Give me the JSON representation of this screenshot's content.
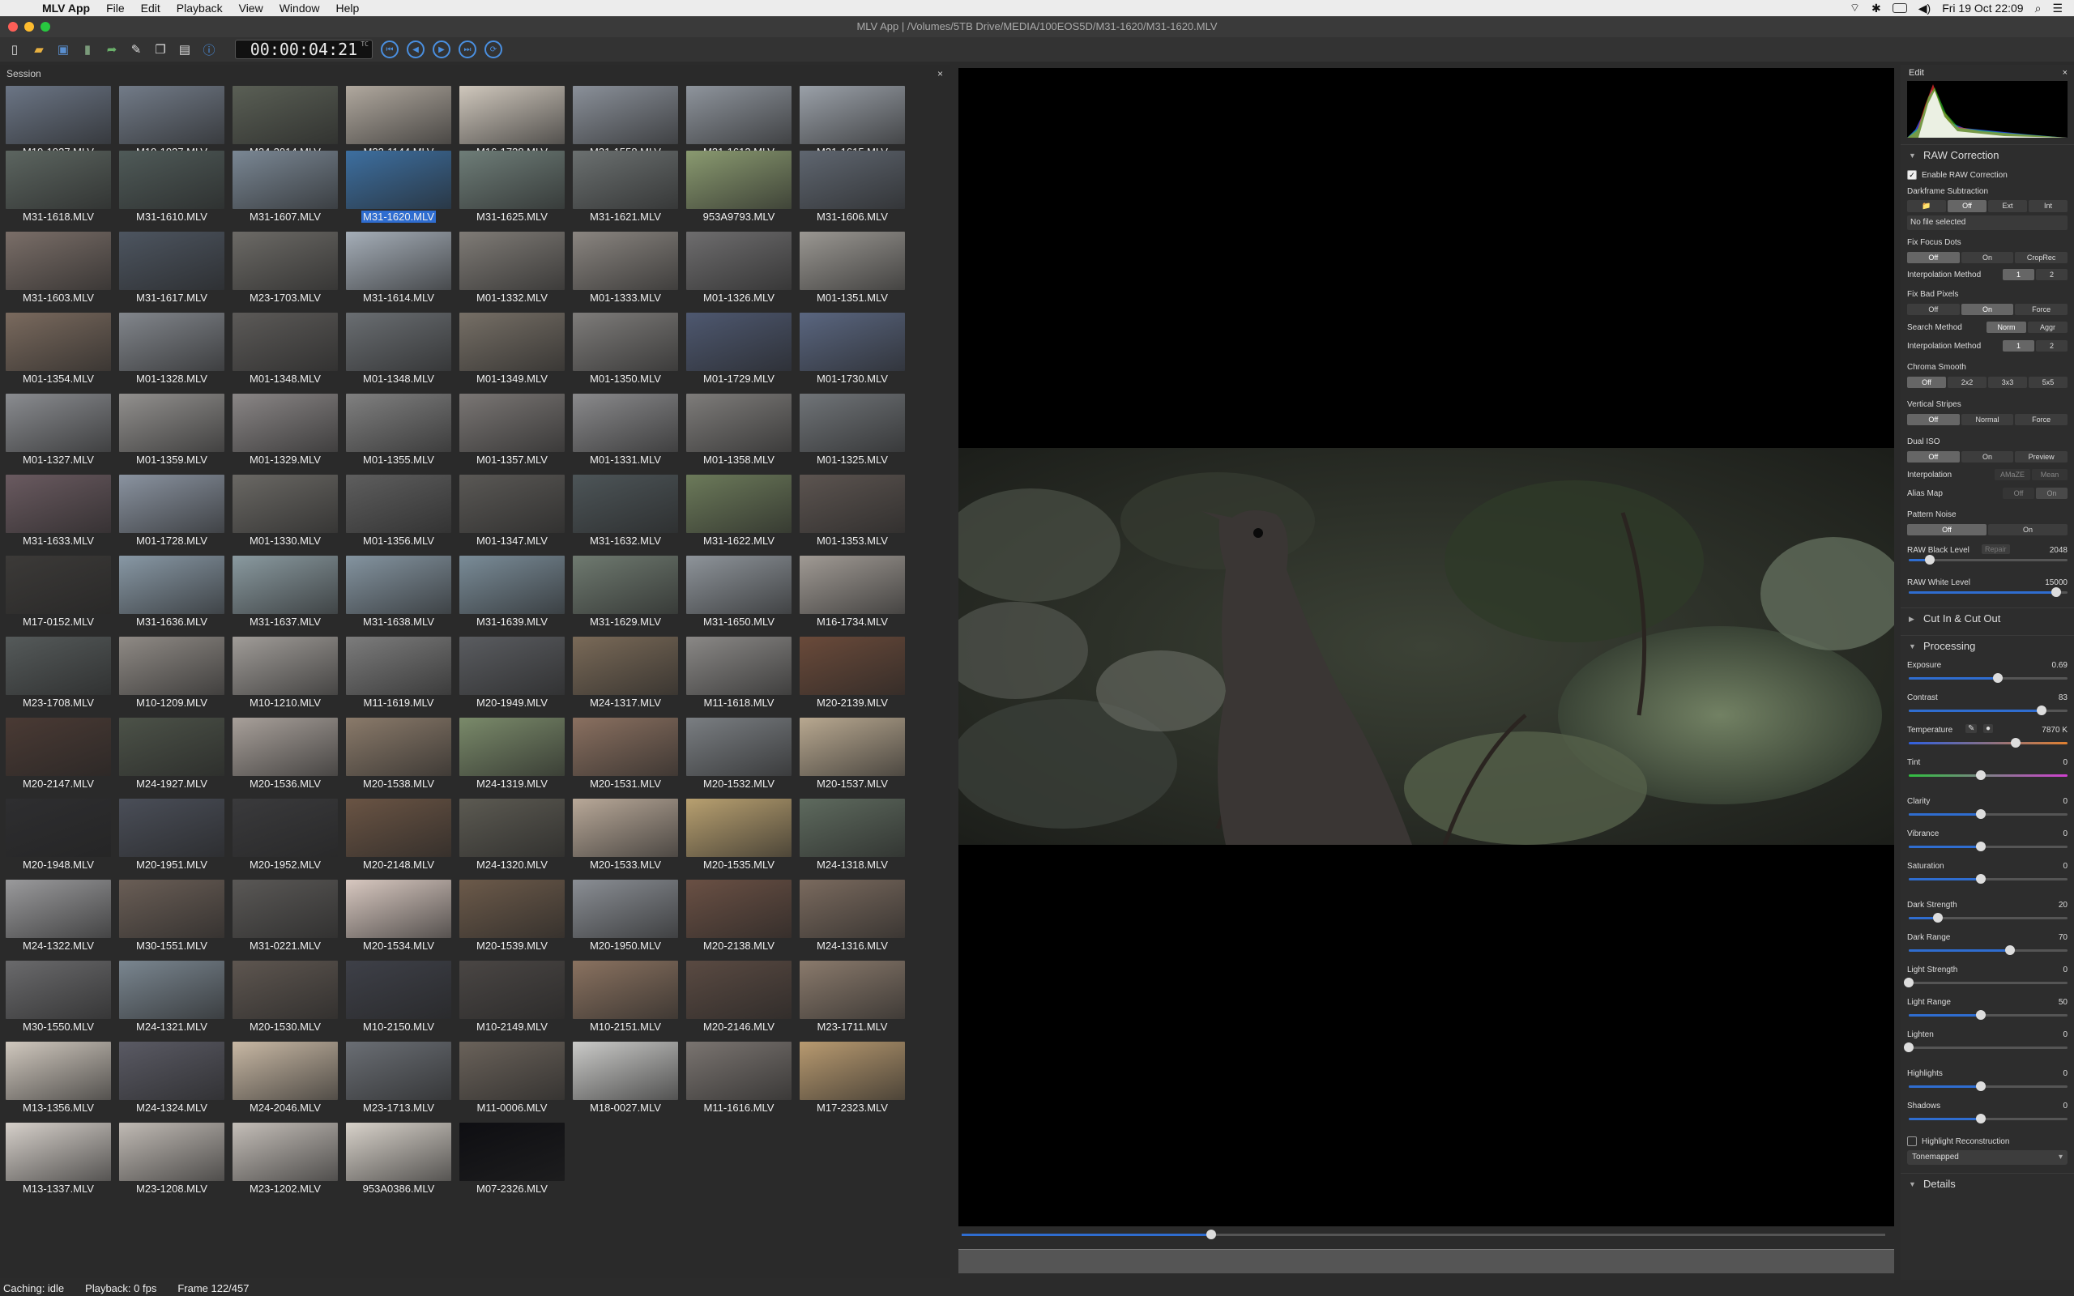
{
  "menubar": {
    "app": "MLV App",
    "menus": [
      "File",
      "Edit",
      "Playback",
      "View",
      "Window",
      "Help"
    ],
    "clock": "Fri 19 Oct  22:09"
  },
  "window": {
    "title": "MLV App | /Volumes/5TB Drive/MEDIA/100EOS5D/M31-1620/M31-1620.MLV"
  },
  "toolbar": {
    "timecode": "00:00:04:21",
    "tc_label": "TC",
    "icons": [
      "new-session-icon",
      "open-icon",
      "save-icon",
      "delete-icon",
      "export-icon",
      "settings-icon",
      "copy-icon",
      "paste-icon",
      "info-icon"
    ],
    "playback": [
      "skip-to-start-icon",
      "step-back-icon",
      "play-icon",
      "step-forward-icon",
      "loop-icon"
    ]
  },
  "session": {
    "header": "Session",
    "close": "×",
    "selected": "M31-1620.MLV",
    "files": [
      "M19-1937.MLV",
      "M19-1937.MLV",
      "M24-2014.MLV",
      "M23-1144.MLV",
      "M16-1738.MLV",
      "M31-1558.MLV",
      "M31-1612.MLV",
      "M31-1615.MLV",
      "M31-1618.MLV",
      "M31-1610.MLV",
      "M31-1607.MLV",
      "M31-1620.MLV",
      "M31-1625.MLV",
      "M31-1621.MLV",
      "953A9793.MLV",
      "M31-1606.MLV",
      "M31-1603.MLV",
      "M31-1617.MLV",
      "M23-1703.MLV",
      "M31-1614.MLV",
      "M01-1332.MLV",
      "M01-1333.MLV",
      "M01-1326.MLV",
      "M01-1351.MLV",
      "M01-1354.MLV",
      "M01-1328.MLV",
      "M01-1348.MLV",
      "M01-1348.MLV",
      "M01-1349.MLV",
      "M01-1350.MLV",
      "M01-1729.MLV",
      "M01-1730.MLV",
      "M01-1327.MLV",
      "M01-1359.MLV",
      "M01-1329.MLV",
      "M01-1355.MLV",
      "M01-1357.MLV",
      "M01-1331.MLV",
      "M01-1358.MLV",
      "M01-1325.MLV",
      "M31-1633.MLV",
      "M01-1728.MLV",
      "M01-1330.MLV",
      "M01-1356.MLV",
      "M01-1347.MLV",
      "M31-1632.MLV",
      "M31-1622.MLV",
      "M01-1353.MLV",
      "M17-0152.MLV",
      "M31-1636.MLV",
      "M31-1637.MLV",
      "M31-1638.MLV",
      "M31-1639.MLV",
      "M31-1629.MLV",
      "M31-1650.MLV",
      "M16-1734.MLV",
      "M23-1708.MLV",
      "M10-1209.MLV",
      "M10-1210.MLV",
      "M11-1619.MLV",
      "M20-1949.MLV",
      "M24-1317.MLV",
      "M11-1618.MLV",
      "M20-2139.MLV",
      "M20-2147.MLV",
      "M24-1927.MLV",
      "M20-1536.MLV",
      "M20-1538.MLV",
      "M24-1319.MLV",
      "M20-1531.MLV",
      "M20-1532.MLV",
      "M20-1537.MLV",
      "M20-1948.MLV",
      "M20-1951.MLV",
      "M20-1952.MLV",
      "M20-2148.MLV",
      "M24-1320.MLV",
      "M20-1533.MLV",
      "M20-1535.MLV",
      "M24-1318.MLV",
      "M24-1322.MLV",
      "M30-1551.MLV",
      "M31-0221.MLV",
      "M20-1534.MLV",
      "M20-1539.MLV",
      "M20-1950.MLV",
      "M20-2138.MLV",
      "M24-1316.MLV",
      "M30-1550.MLV",
      "M24-1321.MLV",
      "M20-1530.MLV",
      "M10-2150.MLV",
      "M10-2149.MLV",
      "M10-2151.MLV",
      "M20-2146.MLV",
      "M23-1711.MLV",
      "M13-1356.MLV",
      "M24-1324.MLV",
      "M24-2046.MLV",
      "M23-1713.MLV",
      "M11-0006.MLV",
      "M18-0027.MLV",
      "M11-1616.MLV",
      "M17-2323.MLV",
      "M13-1337.MLV",
      "M23-1208.MLV",
      "M23-1202.MLV",
      "953A0386.MLV",
      "M07-2326.MLV"
    ],
    "thumb_colors": [
      "#6b7585",
      "#727b88",
      "#5a5f55",
      "#b0a89e",
      "#cfc7bc",
      "#8a9099",
      "#8e949c",
      "#9aa0a8",
      "#5c6560",
      "#4f5a58",
      "#7a8794",
      "#3d6fa0",
      "#6e7d78",
      "#6b7070",
      "#8a9a70",
      "#5f6670",
      "#7a6e68",
      "#4d5560",
      "#6c6a66",
      "#a5aeb8",
      "#7f7b76",
      "#8a8580",
      "#6e6d6e",
      "#9a9792",
      "#7a6a5e",
      "#82868c",
      "#5c5a58",
      "#6a6e72",
      "#766f66",
      "#7e7c7a",
      "#4e5870",
      "#5a6680",
      "#8a8c90",
      "#92908e",
      "#8a8686",
      "#808080",
      "#7a7674",
      "#8a8a8c",
      "#7e7c7a",
      "#707478",
      "#6a5a60",
      "#8a93a0",
      "#6a6864",
      "#5e5e5e",
      "#5a5855",
      "#4d5558",
      "#6c7a5a",
      "#5c5450",
      "#3c3a38",
      "#8898a5",
      "#8a9aa0",
      "#8494a0",
      "#7a8c98",
      "#6f7a70",
      "#8e949a",
      "#a09a94",
      "#555a5a",
      "#8f8a85",
      "#a09c98",
      "#7c7c7c",
      "#5a5c60",
      "#7a6a58",
      "#8a8886",
      "#6a4a3a",
      "#4a3a34",
      "#4c5248",
      "#a8a09a",
      "#8a7a6a",
      "#7a8a6a",
      "#8a7060",
      "#7a7e82",
      "#b8a890",
      "#2e2e30",
      "#4a4e58",
      "#3a3a3c",
      "#6a5444",
      "#5c5a52",
      "#b8a898",
      "#b8a070",
      "#5e6a5e",
      "#9a9a9c",
      "#6a5e56",
      "#5a5856",
      "#d8c8c0",
      "#6c5a4a",
      "#8a8e94",
      "#6a5044",
      "#7a6a5e",
      "#6a6a6c",
      "#7a8690",
      "#5e5650",
      "#3e4048",
      "#4a4644",
      "#8a7260",
      "#5a4a42",
      "#8a7a6c",
      "#d0c8be",
      "#5a5a64",
      "#c8b8a4",
      "#6a6e74",
      "#6a625a",
      "#cacac8",
      "#7a7470",
      "#b89a70",
      "#d6d0ca",
      "#c0bab4",
      "#c4beb8",
      "#d8d2ca",
      "#0e0e12"
    ]
  },
  "viewer": {
    "clip": "M31-1620.MLV",
    "frame": 122,
    "total_frames": 457
  },
  "status": {
    "caching": "Caching: idle",
    "playback": "Playback: 0 fps",
    "frame": "Frame 122/457"
  },
  "edit": {
    "header": "Edit",
    "close": "×",
    "raw": {
      "title": "RAW Correction",
      "enable": "Enable RAW Correction",
      "darkframe": "Darkframe Subtraction",
      "df_opts": [
        "📁",
        "Off",
        "Ext",
        "Int"
      ],
      "nofile": "No file selected",
      "focus": "Fix Focus Dots",
      "focus_opts": [
        "Off",
        "On",
        "CropRec"
      ],
      "interp": "Interpolation Method",
      "interp_opts": [
        "1",
        "2"
      ],
      "bad": "Fix Bad Pixels",
      "bad_opts": [
        "Off",
        "On",
        "Force"
      ],
      "search": "Search Method",
      "search_opts": [
        "Norm",
        "Aggr"
      ],
      "interp2_opts": [
        "1",
        "2"
      ],
      "chroma": "Chroma Smooth",
      "chroma_opts": [
        "Off",
        "2x2",
        "3x3",
        "5x5"
      ],
      "stripes": "Vertical Stripes",
      "stripes_opts": [
        "Off",
        "Normal",
        "Force"
      ],
      "dual": "Dual ISO",
      "dual_opts": [
        "Off",
        "On",
        "Preview"
      ],
      "interpolation": "Interpolation",
      "interp3_opts": [
        "AMaZE",
        "Mean"
      ],
      "alias": "Alias Map",
      "alias_opts": [
        "Off",
        "On"
      ],
      "pattern": "Pattern Noise",
      "pattern_opts": [
        "Off",
        "On"
      ],
      "black": "RAW Black Level",
      "black_btn": "Repair",
      "black_val": "2048",
      "white": "RAW White Level",
      "white_val": "15000"
    },
    "cut": {
      "title": "Cut In & Cut Out"
    },
    "processing": {
      "title": "Processing",
      "sliders": [
        {
          "label": "Exposure",
          "value": "0.69",
          "pos": 0.62
        },
        {
          "label": "Contrast",
          "value": "83",
          "pos": 0.92
        },
        {
          "label": "Temperature",
          "value": "7870 K",
          "pos": 0.74
        },
        {
          "label": "Tint",
          "value": "0",
          "pos": 0.5
        },
        {
          "label": "Clarity",
          "value": "0",
          "pos": 0.5
        },
        {
          "label": "Vibrance",
          "value": "0",
          "pos": 0.5
        },
        {
          "label": "Saturation",
          "value": "0",
          "pos": 0.5
        },
        {
          "label": "Dark Strength",
          "value": "20",
          "pos": 0.2
        },
        {
          "label": "Dark Range",
          "value": "70",
          "pos": 0.7
        },
        {
          "label": "Light Strength",
          "value": "0",
          "pos": 0
        },
        {
          "label": "Light Range",
          "value": "50",
          "pos": 0.5
        },
        {
          "label": "Lighten",
          "value": "0",
          "pos": 0
        },
        {
          "label": "Highlights",
          "value": "0",
          "pos": 0.5
        },
        {
          "label": "Shadows",
          "value": "0",
          "pos": 0.5
        }
      ],
      "highlight_recon": "Highlight Reconstruction",
      "tonemap": "Tonemapped"
    },
    "details": {
      "title": "Details"
    }
  },
  "colors": {
    "accent": "#2f6dd0",
    "temp_left": "#3060e0",
    "temp_right": "#e08030",
    "tint_left": "#30c040",
    "tint_right": "#d040d0"
  }
}
